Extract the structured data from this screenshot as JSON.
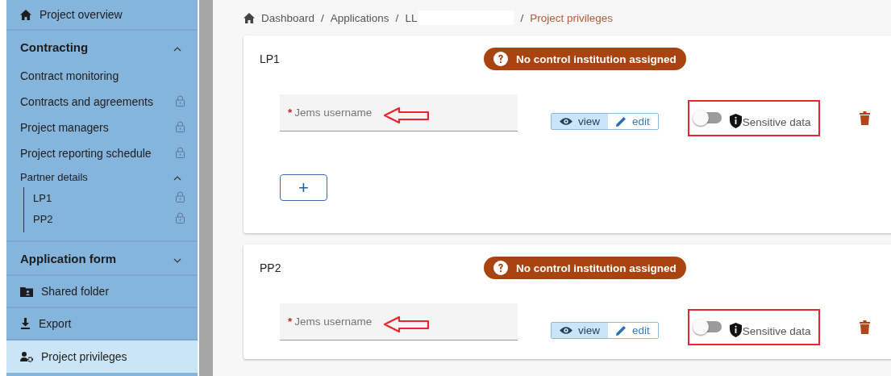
{
  "sidebar": {
    "items": [
      {
        "kind": "link",
        "label": "Project overview",
        "selected": false
      },
      {
        "kind": "section",
        "label": "Contracting",
        "expanded": true,
        "children": [
          {
            "kind": "item",
            "label": "Contract monitoring",
            "locked": false
          },
          {
            "kind": "item",
            "label": "Contracts and agreements",
            "locked": true
          },
          {
            "kind": "item",
            "label": "Project managers",
            "locked": true
          },
          {
            "kind": "item",
            "label": "Project reporting schedule",
            "locked": true
          },
          {
            "kind": "group",
            "label": "Partner details",
            "expanded": true,
            "children": [
              {
                "label": "LP1",
                "locked": true
              },
              {
                "label": "PP2",
                "locked": true
              }
            ]
          }
        ]
      },
      {
        "kind": "section",
        "label": "Application form",
        "expanded": false
      },
      {
        "kind": "link",
        "label": "Shared folder",
        "selected": false
      },
      {
        "kind": "link",
        "label": "Export",
        "selected": false
      },
      {
        "kind": "link",
        "label": "Project privileges",
        "selected": true
      }
    ]
  },
  "breadcrumb_separator": "/",
  "breadcrumb": [
    {
      "label": "Dashboard",
      "current": false
    },
    {
      "label": "Applications",
      "current": false
    },
    {
      "label": "LL",
      "current": false,
      "redacted": true
    },
    {
      "label": "Project privileges",
      "current": true
    }
  ],
  "partners": [
    {
      "name": "LP1",
      "badge": "No control institution assigned",
      "users": [
        {
          "placeholder": "Jems username",
          "required_mark": "*",
          "permissions": [
            {
              "label": "view",
              "selected": true
            },
            {
              "label": "edit",
              "selected": false
            }
          ],
          "sensitive_label": "Sensitive data",
          "sensitive": false
        }
      ],
      "add_button": "+"
    },
    {
      "name": "PP2",
      "badge": "No control institution assigned",
      "users": [
        {
          "placeholder": "Jems username",
          "required_mark": "*",
          "permissions": [
            {
              "label": "view",
              "selected": true
            },
            {
              "label": "edit",
              "selected": false
            }
          ],
          "sensitive_label": "Sensitive data",
          "sensitive": false
        }
      ]
    }
  ]
}
